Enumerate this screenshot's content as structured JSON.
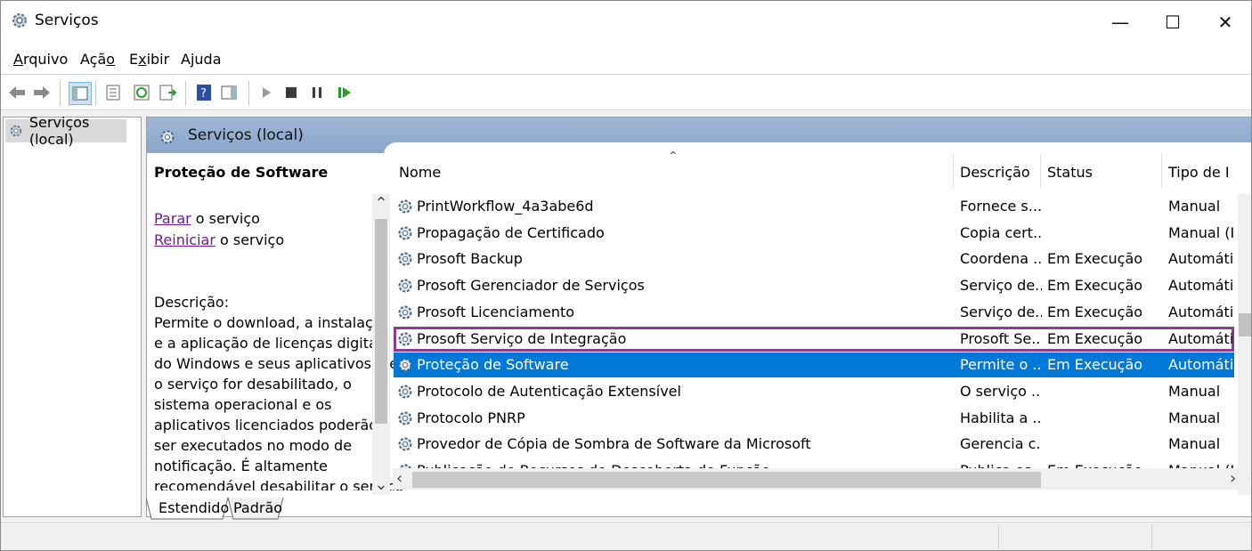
{
  "window": {
    "title": "Serviços",
    "buttons": {
      "minimize": "—",
      "maximize": "☐",
      "close": "✕"
    }
  },
  "menu": [
    {
      "u": "A",
      "rest": "rquivo"
    },
    {
      "pre": "Açã",
      "u": "o",
      "rest": ""
    },
    {
      "pre": "E",
      "u": "x",
      "rest": "ibir"
    },
    {
      "pre": "A",
      "u": "j",
      "rest": "uda"
    }
  ],
  "tree": {
    "root": "Serviços (local)"
  },
  "content": {
    "header": "Serviços (local)",
    "selected_service": "Proteção de Software",
    "actions": [
      {
        "link": "Parar",
        "text": " o serviço"
      },
      {
        "link": "Reiniciar",
        "text": " o serviço"
      }
    ],
    "description_label": "Descrição:",
    "description_lines": [
      "Permite o download, a instalação",
      "e a aplicação de licenças digitais",
      "do Windows e seus aplicativos. Se",
      "o serviço for desabilitado, o",
      "sistema operacional e os",
      "aplicativos licenciados poderão",
      "ser executados no modo de",
      "notificação. É altamente",
      "recomendável desabilitar o serviço"
    ]
  },
  "columns": {
    "name": "Nome",
    "description": "Descrição",
    "status": "Status",
    "startup": "Tipo de Ini"
  },
  "rows": [
    {
      "name": "PrintWorkflow_4a3abe6d",
      "description": "Fornece s...",
      "status": "",
      "startup": "Manual"
    },
    {
      "name": "Propagação de Certificado",
      "description": "Copia cert...",
      "status": "",
      "startup": "Manual (Ir"
    },
    {
      "name": "Prosoft Backup",
      "description": "Coordena ...",
      "status": "Em Execução",
      "startup": "Automátic"
    },
    {
      "name": "Prosoft Gerenciador de Serviços",
      "description": "Serviço de...",
      "status": "Em Execução",
      "startup": "Automátic"
    },
    {
      "name": "Prosoft Licenciamento",
      "description": "Serviço de...",
      "status": "Em Execução",
      "startup": "Automátic"
    },
    {
      "name": "Prosoft Serviço de Integração",
      "description": "Prosoft Se...",
      "status": "Em Execução",
      "startup": "Automátic"
    },
    {
      "name": "Proteção de Software",
      "description": "Permite o ...",
      "status": "Em Execução",
      "startup": "Automátic"
    },
    {
      "name": "Protocolo de Autenticação Extensível",
      "description": "O serviço ...",
      "status": "",
      "startup": "Manual"
    },
    {
      "name": "Protocolo PNRP",
      "description": "Habilita a ...",
      "status": "",
      "startup": "Manual"
    },
    {
      "name": "Provedor de Cópia de Sombra de Software da Microsoft",
      "description": "Gerencia c...",
      "status": "",
      "startup": "Manual"
    },
    {
      "name": "Publicação de Recursos de Descoberta de Função",
      "description": "Publica es...",
      "status": "Em Execução",
      "startup": "Manual (Ir"
    }
  ],
  "tabs": [
    "Estendido",
    "Padrão"
  ],
  "colors": {
    "selection": "#0078d7",
    "outline": "#8e3a96",
    "link": "#6a1b9a",
    "header": "#8aa6cc"
  }
}
